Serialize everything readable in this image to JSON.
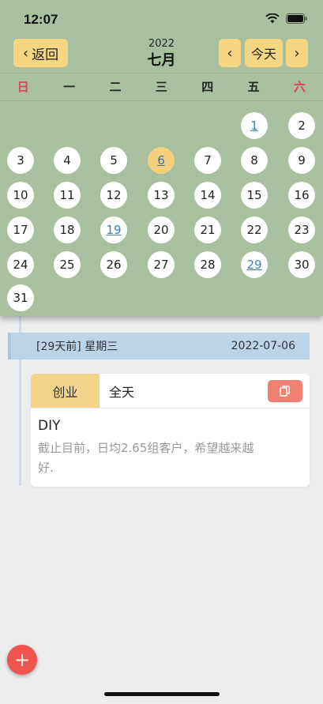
{
  "status_bar": {
    "time": "12:07"
  },
  "header": {
    "back_label": "返回",
    "year": "2022",
    "month": "七月",
    "prev_icon": "chevron-left-icon",
    "today_label": "今天",
    "next_icon": "chevron-right-icon"
  },
  "weekdays": [
    "日",
    "一",
    "二",
    "三",
    "四",
    "五",
    "六"
  ],
  "days": [
    "1",
    "2",
    "3",
    "4",
    "5",
    "6",
    "7",
    "8",
    "9",
    "10",
    "11",
    "12",
    "13",
    "14",
    "15",
    "16",
    "17",
    "18",
    "19",
    "20",
    "21",
    "22",
    "23",
    "24",
    "25",
    "26",
    "27",
    "28",
    "29",
    "30",
    "31"
  ],
  "selected_day": "6",
  "marked_days": [
    "1",
    "19",
    "29"
  ],
  "event": {
    "relative": "[29天前]",
    "weekday": "星期三",
    "date": "2022-07-06",
    "tag": "创业",
    "all_day": "全天",
    "title": "DIY",
    "body": "截止目前，日均2.65组客户，希望越来越好."
  },
  "fab_label": "+",
  "colors": {
    "calendar_bg": "#a9c0a0",
    "accent_yellow": "#f6d680",
    "weekend_red": "#e0405a",
    "fab_red": "#f0544f",
    "copy_button": "#f08070",
    "date_bar": "#bcd4ea"
  }
}
